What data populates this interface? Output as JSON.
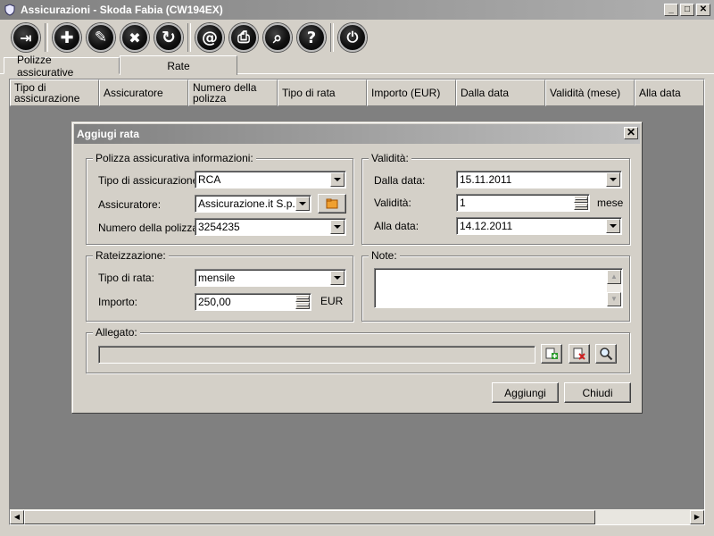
{
  "window": {
    "title": "Assicurazioni - Skoda Fabia (CW194EX)",
    "minimize": "_",
    "maximize": "□",
    "close": "✕"
  },
  "toolbar": {
    "buttons": [
      {
        "name": "exit-button",
        "icon": "exit-icon",
        "glyph": "⇥"
      },
      {
        "name": "add-button",
        "icon": "plus-icon",
        "glyph": "✚"
      },
      {
        "name": "edit-button",
        "icon": "pencil-icon",
        "glyph": "✎"
      },
      {
        "name": "delete-button",
        "icon": "x-icon",
        "glyph": "✖"
      },
      {
        "name": "refresh-button",
        "icon": "refresh-icon",
        "glyph": "↻"
      },
      {
        "name": "email-button",
        "icon": "at-icon",
        "glyph": "@"
      },
      {
        "name": "print-button",
        "icon": "printer-icon",
        "glyph": "⎙"
      },
      {
        "name": "search-button",
        "icon": "search-icon",
        "glyph": "⌕"
      },
      {
        "name": "help-button",
        "icon": "question-icon",
        "glyph": "?"
      },
      {
        "name": "power-button",
        "icon": "power-icon",
        "glyph": "⏻"
      }
    ]
  },
  "tabs": [
    {
      "label": "Polizze assicurative",
      "active": false
    },
    {
      "label": "Rate",
      "active": true
    }
  ],
  "grid": {
    "columns": [
      "Tipo di assicurazione",
      "Assicuratore",
      "Numero della polizza",
      "Tipo di rata",
      "Importo (EUR)",
      "Dalla data",
      "Validità (mese)",
      "Alla data"
    ]
  },
  "dialog": {
    "title": "Aggiugi rata",
    "close": "✕",
    "policy_group": {
      "legend": "Polizza assicurativa informazioni:",
      "type_label": "Tipo di assicurazione:",
      "type_value": "RCA",
      "insurer_label": "Assicuratore:",
      "insurer_value": "Assicurazione.it S.p.A.",
      "number_label": "Numero della polizza:",
      "number_value": "3254235"
    },
    "validity_group": {
      "legend": "Validità:",
      "from_label": "Dalla data:",
      "from_value": "15.11.2011",
      "validity_label": "Validità:",
      "validity_value": "1",
      "validity_unit": "mese",
      "to_label": "Alla data:",
      "to_value": "14.12.2011"
    },
    "installment_group": {
      "legend": "Rateizzazione:",
      "type_label": "Tipo di rata:",
      "type_value": "mensile",
      "amount_label": "Importo:",
      "amount_value": "250,00",
      "amount_unit": "EUR"
    },
    "notes_group": {
      "legend": "Note:",
      "value": ""
    },
    "attachment_group": {
      "legend": "Allegato:",
      "value": ""
    },
    "buttons": {
      "add": "Aggiungi",
      "close": "Chiudi"
    }
  }
}
